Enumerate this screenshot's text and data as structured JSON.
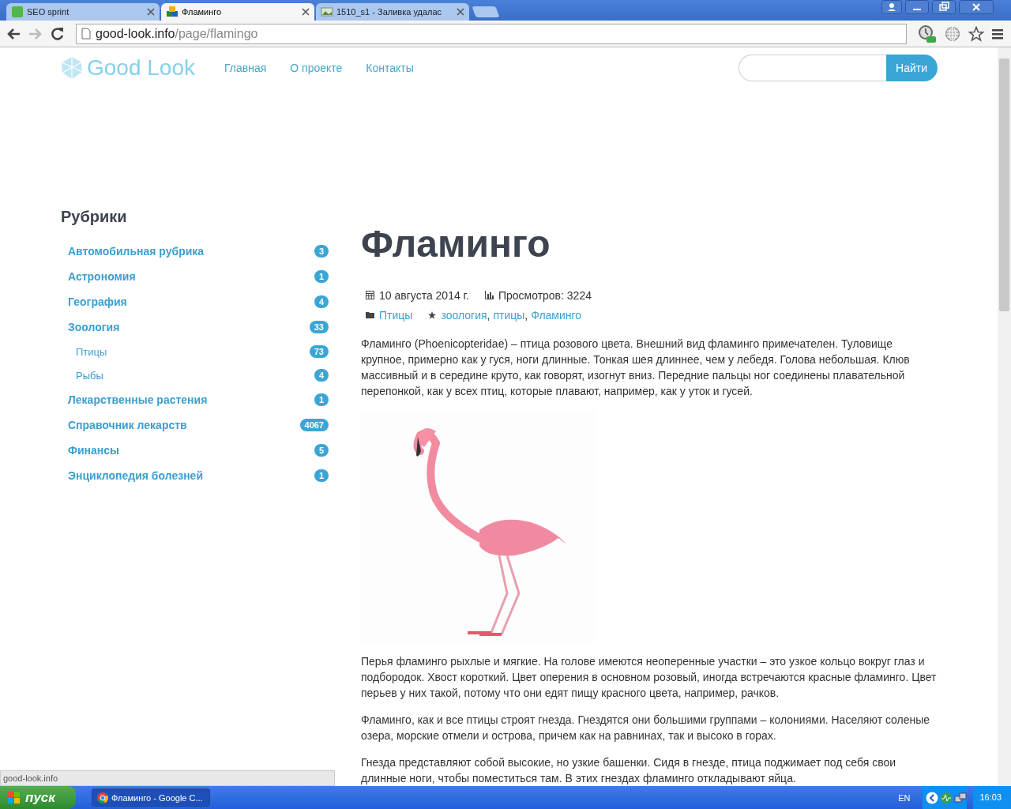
{
  "browser": {
    "tabs": [
      {
        "title": "SEO sprint",
        "selected": false
      },
      {
        "title": "Фламинго",
        "selected": true
      },
      {
        "title": "1510_s1 - Заливка удалас",
        "selected": false
      }
    ],
    "address": {
      "host": "good-look.info",
      "path": "/page/flamingo"
    }
  },
  "site": {
    "logo": "Good Look",
    "nav": [
      "Главная",
      "О проекте",
      "Контакты"
    ],
    "search_button": "Найти"
  },
  "sidebar": {
    "title": "Рубрики",
    "items": [
      {
        "label": "Автомобильная рубрика",
        "count": "3"
      },
      {
        "label": "Астрономия",
        "count": "1"
      },
      {
        "label": "География",
        "count": "4"
      },
      {
        "label": "Зоология",
        "count": "33",
        "children": [
          {
            "label": "Птицы",
            "count": "73"
          },
          {
            "label": "Рыбы",
            "count": "4"
          }
        ]
      },
      {
        "label": "Лекарственные растения",
        "count": "1"
      },
      {
        "label": "Справочник лекарств",
        "count": "4067"
      },
      {
        "label": "Финансы",
        "count": "5"
      },
      {
        "label": "Энциклопедия болезней",
        "count": "1"
      }
    ]
  },
  "article": {
    "title": "Фламинго",
    "date": "10 августа 2014 г.",
    "views": "Просмотров: 3224",
    "category": "Птицы",
    "tags": [
      "зоология",
      "птицы",
      "Фламинго"
    ],
    "tag_separator": ",",
    "intro": "Фламинго (Phoenicopteridae) – птица розового цвета. Внешний вид фламинго примечателен. Туловище крупное, примерно как у гуся, ноги длинные. Тонкая шея длиннее, чем у лебедя. Голова небольшая. Клюв массивный и в середине круто, как говорят, изогнут вниз. Передние пальцы ног соединены плавательной перепонкой, как у всех птиц, которые плавают, например, как у уток и гусей.",
    "paragraphs": [
      "Перья фламинго рыхлые и мягкие. На голове имеются неоперенные участки – это узкое кольцо вокруг глаз и подбородок. Хвост короткий. Цвет оперения в основном розовый, иногда встречаются красные фламинго. Цвет перьев у них такой, потому что они едят пищу красного цвета, например, рачков.",
      "Фламинго, как и все птицы строят гнезда. Гнездятся они большими группами – колониями. Населяют соленые озера, морские отмели и острова, причем как на равнинах, так и высоко в горах.",
      "Гнезда представляют собой высокие, но узкие башенки. Сидя в гнезде, птица поджимает под себя свои длинные ноги, чтобы поместиться там. В этих гнездах фламинго откладывают яйца."
    ]
  },
  "status_bubble": "good-look.info",
  "taskbar": {
    "start": "пуск",
    "windows": [
      {
        "title": "Фламинго - Google C...",
        "selected": true
      }
    ],
    "language": "EN",
    "clock": "16:03"
  }
}
